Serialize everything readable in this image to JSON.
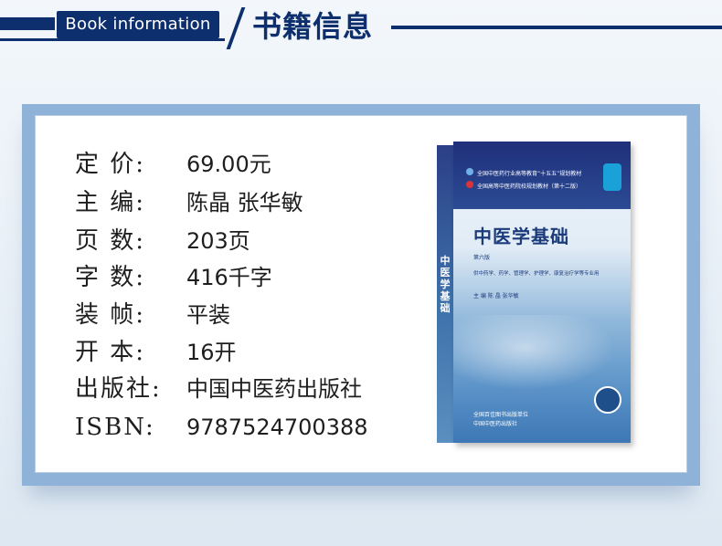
{
  "header": {
    "english_label": "Book information",
    "chinese_title": "书籍信息"
  },
  "info": [
    {
      "label": "定 价:",
      "value": "69.00元"
    },
    {
      "label": "主 编:",
      "value": "陈晶 张华敏"
    },
    {
      "label": "页 数:",
      "value": "203页"
    },
    {
      "label": "字 数:",
      "value": "416千字"
    },
    {
      "label": "装 帧:",
      "value": "平装"
    },
    {
      "label": "开 本:",
      "value": "16开"
    },
    {
      "label": "出版社:",
      "value": "中国中医药出版社"
    },
    {
      "label": "ISBN:",
      "value": "9787524700388"
    }
  ],
  "book_cover": {
    "series_line_1": "全国中医药行业高等教育“十五五”规划教材",
    "series_line_2": "全国高等中医药院校规划教材（第十二版）",
    "title": "中医学基础",
    "edition": "第六版",
    "for_majors": "供中药学、药学、管理学、护理学、康复治疗学等专业用",
    "editors": "主 编 陈 晶 张华敏",
    "spine_title": "中医学基础",
    "publisher_line_1": "全国百佳图书出版单位",
    "publisher_line_2": "中国中医药出版社"
  },
  "colors": {
    "brand_navy": "#0d2f6e",
    "card_border_blue": "#8fb2d8"
  }
}
